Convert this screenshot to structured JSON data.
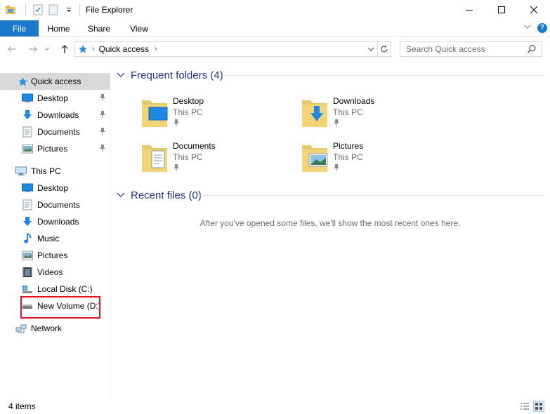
{
  "window": {
    "title": "File Explorer"
  },
  "ribbon": {
    "tabs": [
      "File",
      "Home",
      "Share",
      "View"
    ]
  },
  "address": {
    "crumb": "Quick access",
    "search_placeholder": "Search Quick access"
  },
  "nav": {
    "quick_access": "Quick access",
    "qa_items": [
      "Desktop",
      "Downloads",
      "Documents",
      "Pictures"
    ],
    "this_pc": "This PC",
    "pc_items": [
      "Desktop",
      "Documents",
      "Downloads",
      "Music",
      "Pictures",
      "Videos",
      "Local Disk (C:)",
      "New Volume (D:)"
    ],
    "network": "Network"
  },
  "main": {
    "frequent_header": "Frequent folders (4)",
    "folders": [
      {
        "name": "Desktop",
        "location": "This PC"
      },
      {
        "name": "Downloads",
        "location": "This PC"
      },
      {
        "name": "Documents",
        "location": "This PC"
      },
      {
        "name": "Pictures",
        "location": "This PC"
      }
    ],
    "recent_header": "Recent files (0)",
    "recent_empty": "After you've opened some files, we'll show the most recent ones here."
  },
  "status": {
    "items": "4 items"
  },
  "colors": {
    "accent": "#1979ca",
    "header_blue": "#1e3287",
    "selection_gray": "#d9d9d9",
    "highlight_red": "#e81123"
  }
}
